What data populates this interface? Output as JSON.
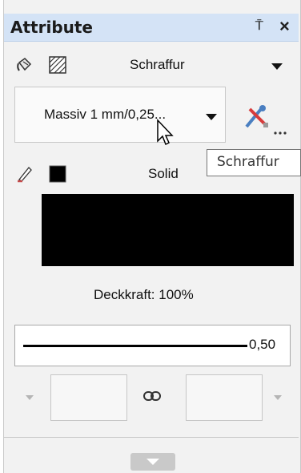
{
  "panel": {
    "title": "Attribute",
    "pin_glyph": "⍑",
    "close_glyph": "×"
  },
  "fill_row": {
    "icons": [
      "paint-bucket-icon",
      "hatch-pattern-icon"
    ],
    "label": "Schraffur"
  },
  "pattern_dropdown": {
    "value": "Massiv 1 mm/0,25...",
    "edit_icon": "hatch-edit-icon",
    "tooltip": "Schraffur"
  },
  "pen_row": {
    "icons": [
      "pen-icon",
      "color-square-icon"
    ],
    "label": "Solid",
    "swatch_color": "#000000"
  },
  "opacity": {
    "label": "Deckkraft: 100%"
  },
  "line_weight": {
    "value": "0,50"
  },
  "dimension_inputs": {
    "left_value": "",
    "right_value": "",
    "link_icon": "chain-link-icon"
  },
  "expand_icon": "chevron-down-icon"
}
